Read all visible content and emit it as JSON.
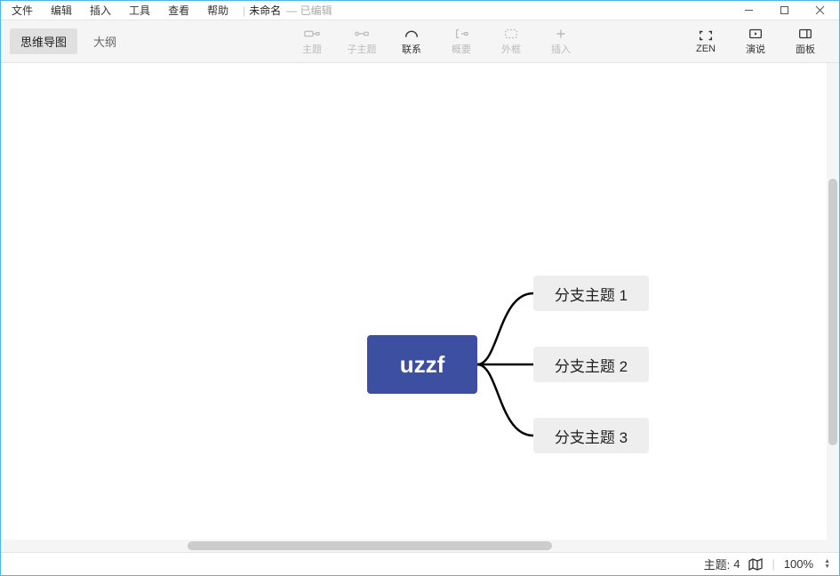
{
  "menu": {
    "file": "文件",
    "edit": "编辑",
    "insert": "插入",
    "tools": "工具",
    "view": "查看",
    "help": "帮助"
  },
  "title": {
    "docname": "未命名",
    "state": "— 已编辑"
  },
  "viewtabs": {
    "mindmap": "思维导图",
    "outline": "大纲"
  },
  "tools": {
    "topic": "主题",
    "subtopic": "子主题",
    "relation": "联系",
    "summary": "概要",
    "boundary": "外框",
    "insert": "插入",
    "zen": "ZEN",
    "present": "演说",
    "panel": "面板"
  },
  "mindmap": {
    "central": "uzzf",
    "branches": [
      "分支主题 1",
      "分支主题 2",
      "分支主题 3"
    ]
  },
  "status": {
    "topics_label": "主题:",
    "topics_count": "4",
    "zoom": "100%"
  }
}
